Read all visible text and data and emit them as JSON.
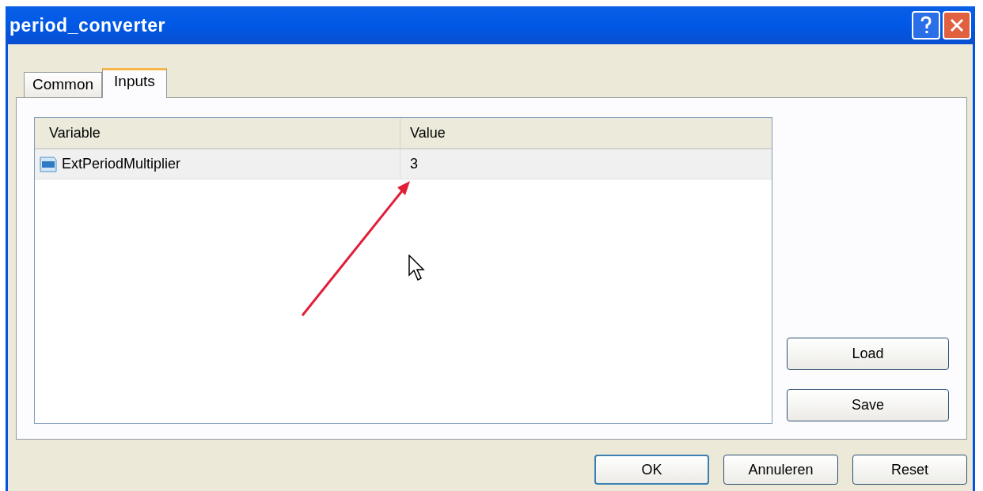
{
  "window": {
    "title": "period_converter"
  },
  "tabs": [
    {
      "label": "Common",
      "selected": false
    },
    {
      "label": "Inputs",
      "selected": true
    }
  ],
  "table": {
    "columns": [
      "Variable",
      "Value"
    ],
    "rows": [
      {
        "variable": "ExtPeriodMultiplier",
        "value": "3",
        "selected": true
      }
    ]
  },
  "side_buttons": [
    "Load",
    "Save"
  ],
  "buttons": [
    {
      "label": "OK",
      "default": true
    },
    {
      "label": "Annuleren",
      "default": false
    },
    {
      "label": "Reset",
      "default": false
    }
  ]
}
